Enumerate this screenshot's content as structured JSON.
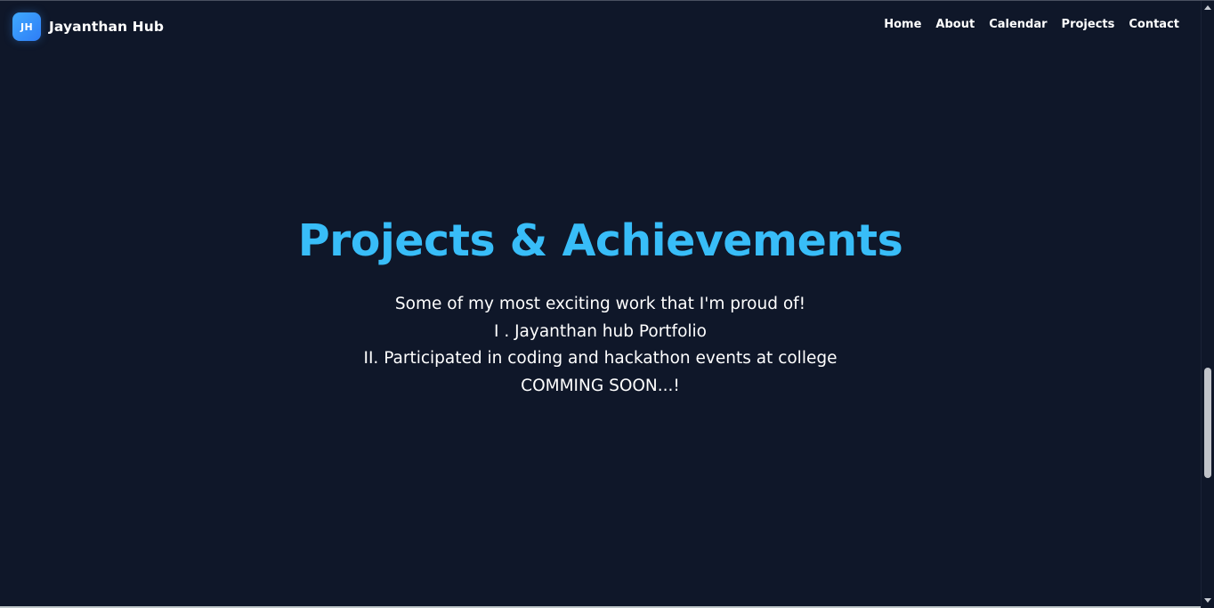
{
  "brand": {
    "logo_text": "JH",
    "name": "Jayanthan Hub"
  },
  "nav": {
    "items": [
      {
        "label": "Home"
      },
      {
        "label": "About"
      },
      {
        "label": "Calendar"
      },
      {
        "label": "Projects"
      },
      {
        "label": "Contact"
      }
    ]
  },
  "hero": {
    "title": "Projects & Achievements",
    "lines": [
      "Some of my most exciting work that I'm proud of!",
      "I . Jayanthan hub Portfolio",
      "II. Participated in coding and hackathon events at college",
      "COMMING SOON...!"
    ]
  },
  "colors": {
    "background": "#0f1729",
    "accent": "#38bdf8",
    "logo_gradient_start": "#3fa9ff",
    "logo_gradient_end": "#2f7df6",
    "text": "#ffffff"
  }
}
